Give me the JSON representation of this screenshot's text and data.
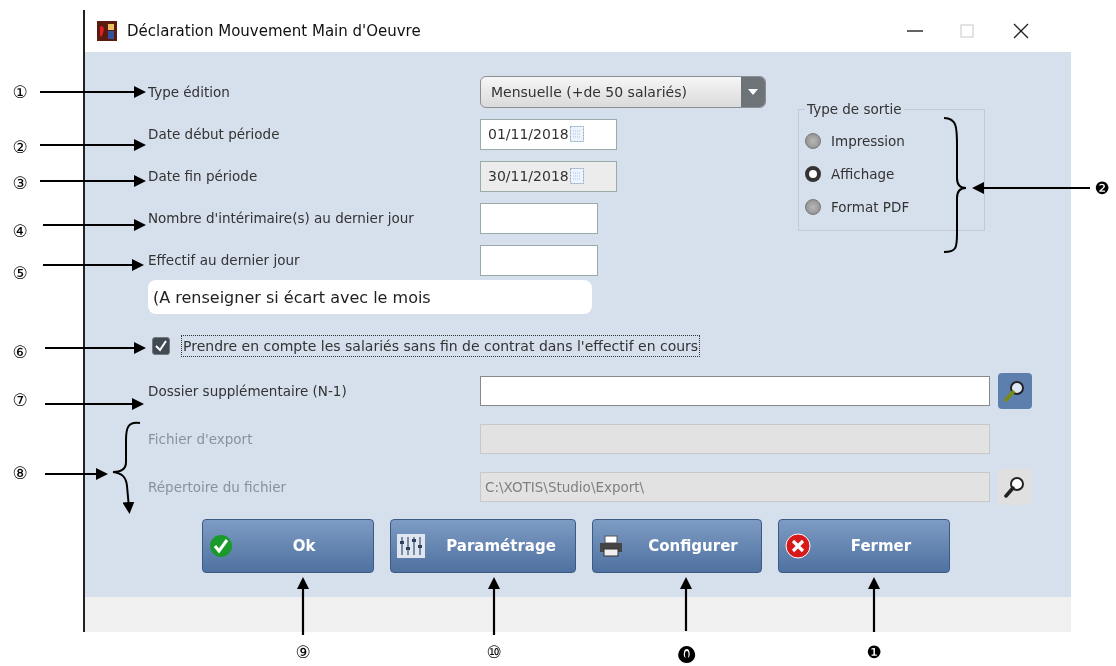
{
  "window": {
    "title": "Déclaration Mouvement Main d'Oeuvre"
  },
  "top_fields": [
    {
      "kind": "combo",
      "label": "Type édition",
      "value": "Mensuelle (+de 50 salariés)"
    },
    {
      "kind": "date",
      "label": "Date début période",
      "value": "01/11/2018",
      "readonly": false
    },
    {
      "kind": "date",
      "label": "Date fin période",
      "value": "30/11/2018",
      "readonly": true
    },
    {
      "kind": "number",
      "label": "Nombre d'intérimaire(s) au dernier jour"
    },
    {
      "kind": "number",
      "label": "Effectif au dernier jour"
    }
  ],
  "note": "(A renseigner si écart avec le mois",
  "output_type": {
    "title": "Type de sortie",
    "options": [
      {
        "label": "Impression",
        "selected": false
      },
      {
        "label": "Affichage",
        "selected": true
      },
      {
        "label": "Format PDF",
        "selected": false
      }
    ]
  },
  "checkbox": {
    "label": "Prendre en compte les salariés sans fin de contrat dans l'effectif en cours",
    "checked": true
  },
  "lower_fields": [
    {
      "label": "Dossier supplémentaire (N-1)",
      "browse": true,
      "disabled": false
    },
    {
      "label": "Fichier d'export",
      "browse": false,
      "disabled": true
    },
    {
      "label": "Répertoire du fichier",
      "value": "C:\\XOTIS\\Studio\\Export\\",
      "browse": true,
      "disabled": true
    }
  ],
  "buttons": [
    {
      "label": "Ok",
      "kind": "check"
    },
    {
      "label": "Paramétrage",
      "kind": "sliders"
    },
    {
      "label": "Configurer",
      "kind": "printer"
    },
    {
      "label": "Fermer",
      "kind": "cross"
    }
  ],
  "annotations": [
    {
      "label": "①",
      "kind": "arrow"
    },
    {
      "label": "②",
      "kind": "arrow"
    },
    {
      "label": "③",
      "kind": "arrow"
    },
    {
      "label": "④",
      "kind": "arrow"
    },
    {
      "label": "⑤",
      "kind": "arrow"
    },
    {
      "label": "❷",
      "kind": "brace"
    },
    {
      "label": "⑥",
      "kind": "arrow"
    },
    {
      "label": "⑦",
      "kind": "arrow"
    },
    {
      "label": "⑧",
      "kind": "brace"
    },
    {
      "label": "⑨",
      "kind": "arrow"
    },
    {
      "label": "⑩",
      "kind": "arrow"
    },
    {
      "label": "⓿",
      "kind": "arrow"
    },
    {
      "label": "❶",
      "kind": "arrow"
    }
  ]
}
